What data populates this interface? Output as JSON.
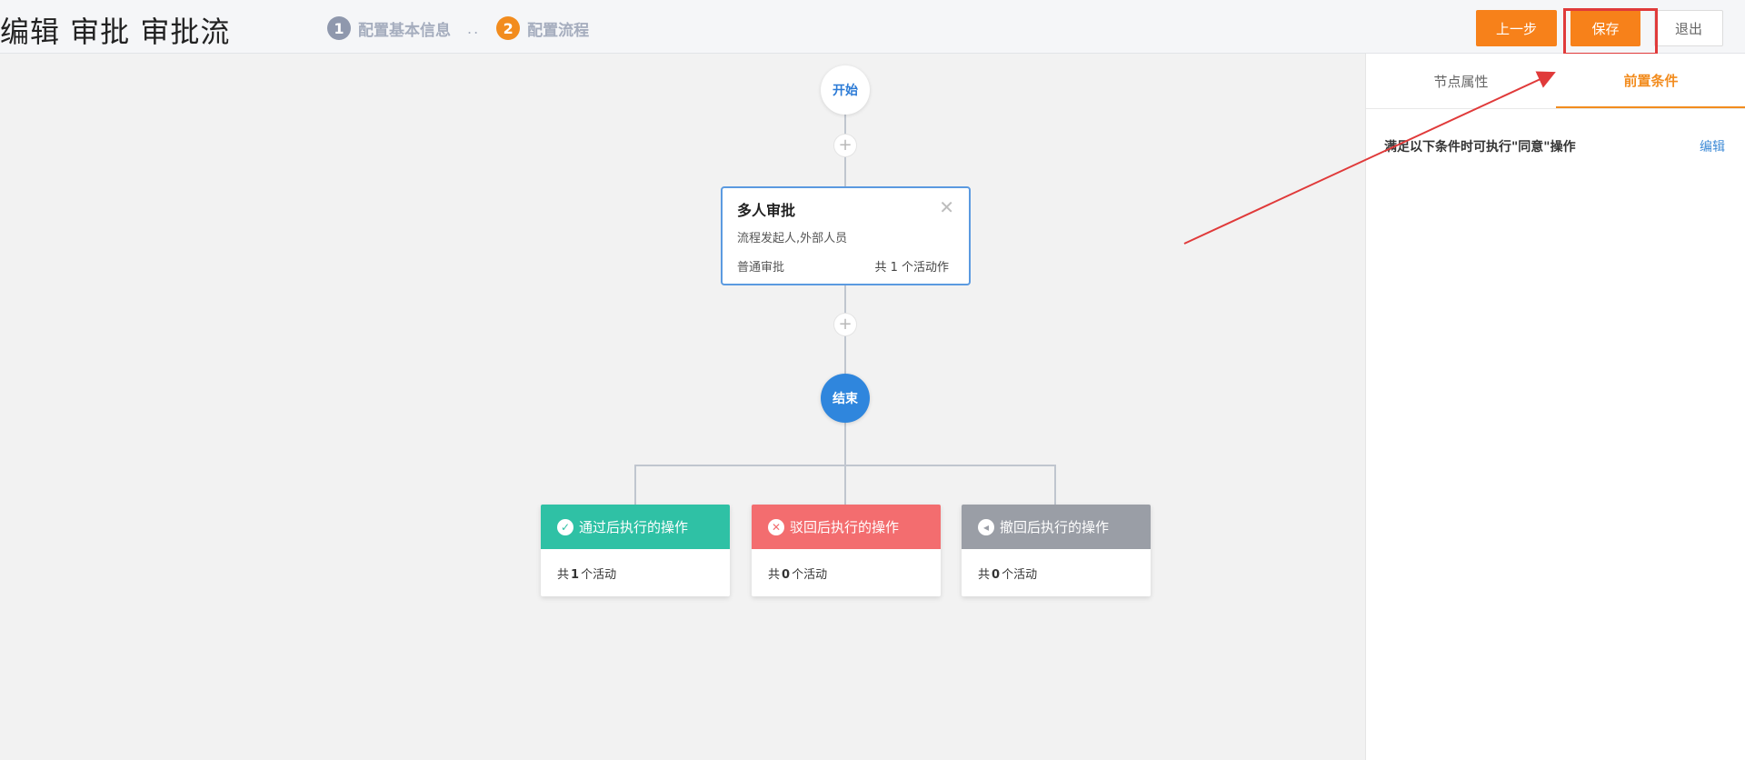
{
  "header": {
    "title": "编辑 审批 审批流",
    "steps": [
      {
        "num": "1",
        "label": "配置基本信息"
      },
      {
        "num": "2",
        "label": "配置流程"
      }
    ],
    "step_separator": "..",
    "buttons": {
      "prev": "上一步",
      "save": "保存",
      "exit": "退出"
    }
  },
  "flow": {
    "start_label": "开始",
    "end_label": "结束",
    "plus_symbol": "+",
    "approval": {
      "title": "多人审批",
      "close_symbol": "✕",
      "participants": "流程发起人,外部人员",
      "type": "普通审批",
      "count_text": "共 1 个活动作"
    },
    "actions": [
      {
        "title": "通过后执行的操作",
        "icon_symbol": "✓",
        "prefix": "共",
        "count": "1",
        "suffix": "个活动",
        "color": "#2fc1a5"
      },
      {
        "title": "驳回后执行的操作",
        "icon_symbol": "✕",
        "prefix": "共",
        "count": "0",
        "suffix": "个活动",
        "color": "#f36d6f"
      },
      {
        "title": "撤回后执行的操作",
        "icon_symbol": "◂",
        "prefix": "共",
        "count": "0",
        "suffix": "个活动",
        "color": "#9a9ea6"
      }
    ]
  },
  "panel": {
    "tabs": [
      "节点属性",
      "前置条件"
    ],
    "active_tab": "前置条件",
    "condition_text": "满足以下条件时可执行\"同意\"操作",
    "edit_label": "编辑"
  },
  "colors": {
    "accent": "#f7811a",
    "primary": "#2f86dd",
    "annotation": "#e03a3a"
  }
}
